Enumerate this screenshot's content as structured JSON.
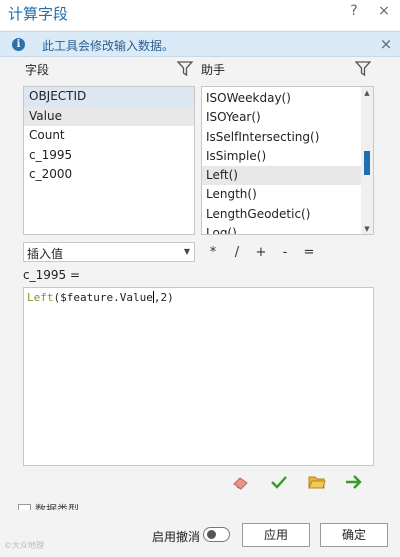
{
  "window": {
    "title": "计算字段",
    "help": "?",
    "close": "×"
  },
  "info": {
    "icon": "i",
    "message": "此工具会修改输入数据。",
    "close": "×"
  },
  "fields": {
    "header": "字段",
    "items": [
      "OBJECTID",
      "Value",
      "Count",
      "c_1995",
      "c_2000"
    ]
  },
  "helpers": {
    "header": "助手",
    "items": [
      "ISOWeekday()",
      "ISOYear()",
      "IsSelfIntersecting()",
      "IsSimple()",
      "Left()",
      "Length()",
      "LengthGeodetic()",
      "Log()"
    ]
  },
  "insert": {
    "label": "插入值"
  },
  "operators": [
    "*",
    "/",
    "+",
    "-",
    "="
  ],
  "expression": {
    "label": "c_1995 =",
    "fn": "Left",
    "open": "(",
    "arg": "$feature.Value",
    "comma": ",",
    "num": "2",
    "close": ")"
  },
  "partial_checkbox_text": "数据类型",
  "footer": {
    "undo_label": "启用撤消",
    "apply": "应用",
    "ok": "确定"
  },
  "watermark": "©大众地理",
  "colors": {
    "accent": "#1f6fb0",
    "info_bg": "#dbeaf7",
    "selection": "#dce7f3",
    "code_function": "#7a9a2a",
    "verify_check": "#3a9a2a",
    "folder": "#d9a02a",
    "run_arrow": "#3a9a2a",
    "eraser": "#e07a6a"
  },
  "icons": [
    "info-icon",
    "filter-icon",
    "eraser-icon",
    "checkmark-icon",
    "folder-icon",
    "arrow-right-icon",
    "chevron-down-icon"
  ]
}
